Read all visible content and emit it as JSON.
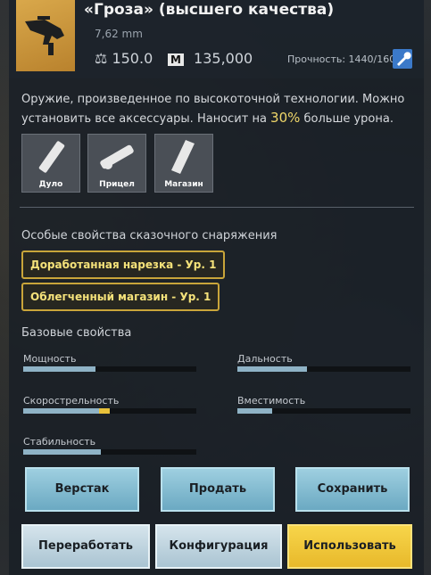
{
  "item": {
    "title": "«Гроза» (высшего качества)",
    "caliber": "7,62 mm",
    "weight": "150.0",
    "price": "135,000",
    "durability": "Прочность: 1440/1600",
    "description_pre": "Оружие, произведенное по высокоточной технологии. Можно установить все аксессуары. Наносит на ",
    "description_highlight": "30%",
    "description_post": " больше урона."
  },
  "slots": [
    {
      "label": "Дуло",
      "icon": "muzzle-icon"
    },
    {
      "label": "Прицел",
      "icon": "scope-icon"
    },
    {
      "label": "Магазин",
      "icon": "magazine-icon"
    }
  ],
  "special": {
    "title": "Особые свойства сказочного снаряжения",
    "items": [
      "Доработанная нарезка - Ур. 1",
      "Облегченный магазин - Ур. 1"
    ]
  },
  "base": {
    "title": "Базовые свойства",
    "props": [
      {
        "label": "Мощность",
        "value": 0.42
      },
      {
        "label": "Дальность",
        "value": 0.4
      },
      {
        "label": "Скорострельность",
        "value": 0.44,
        "bonus": 0.06
      },
      {
        "label": "Вместимость",
        "value": 0.2
      },
      {
        "label": "Стабильность",
        "value": 0.45
      }
    ]
  },
  "buttons": {
    "workbench": "Верстак",
    "sell": "Продать",
    "save": "Сохранить",
    "rework": "Переработать",
    "config": "Конфигурация",
    "use": "Использовать"
  },
  "colors": {
    "accent_gold": "#f0d76a",
    "bar_fill": "#8fb3c6",
    "bonus": "#e8c13a"
  }
}
